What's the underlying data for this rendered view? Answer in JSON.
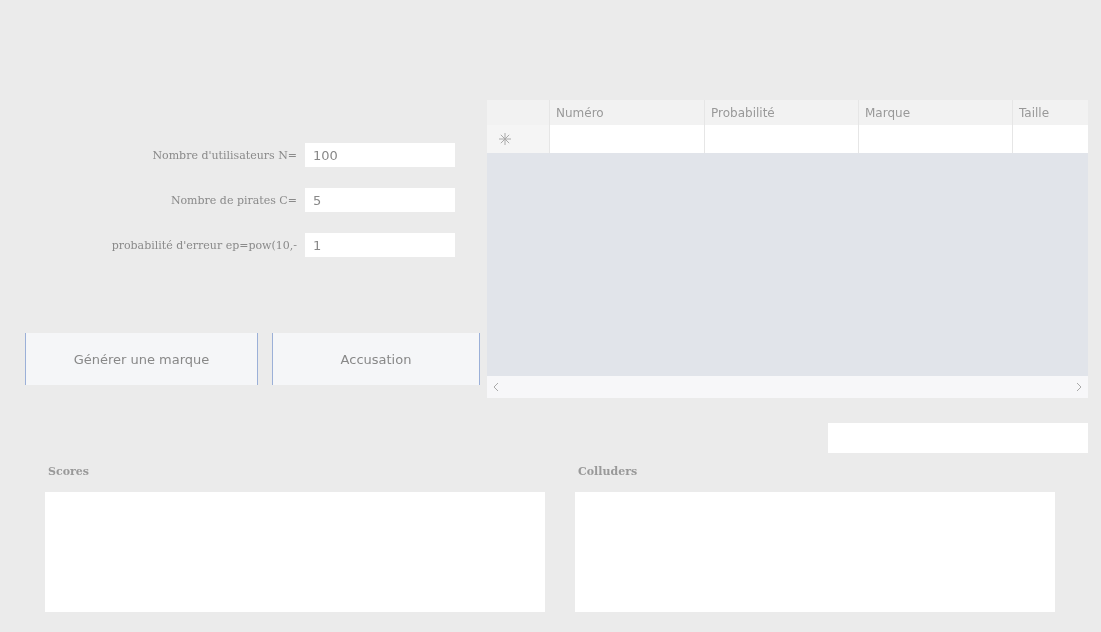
{
  "parameters": [
    {
      "label": "Nombre d'utilisateurs N=",
      "value": "100"
    },
    {
      "label": "Nombre de pirates C=",
      "value": "5"
    },
    {
      "label": "probabilité d'erreur ep=pow(10,-",
      "value": "1"
    }
  ],
  "buttons": [
    "Générer une marque",
    "Accusation"
  ],
  "table": {
    "columns": [
      "Numéro",
      "Probabilité",
      "Marque",
      "Taille"
    ]
  },
  "groups": [
    {
      "label": "Scores"
    },
    {
      "label": "Colluders"
    }
  ]
}
